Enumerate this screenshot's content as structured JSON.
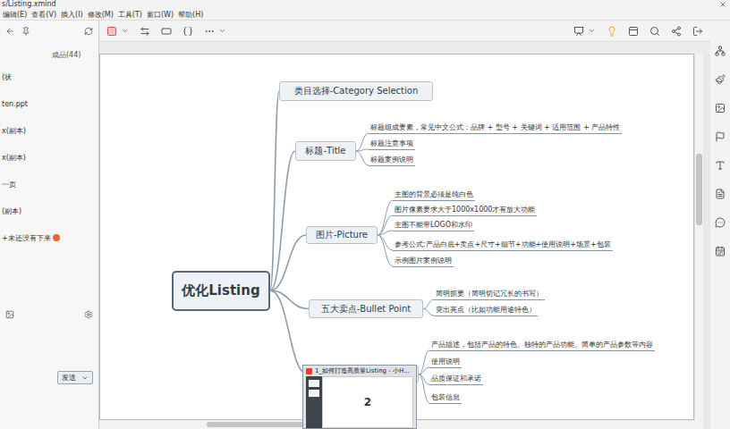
{
  "window": {
    "title": "s/Listing.xmind"
  },
  "menu": [
    "编辑(E)",
    "查看(V)",
    "插入(I)",
    "修改(M)",
    "工具(T)",
    "窗口(W)",
    "帮助(H)"
  ],
  "side_panel": {
    "group": "成品(44)",
    "items": [
      {
        "label": "(状",
        "badge": false
      },
      {
        "label": "ten.ppt",
        "badge": false
      },
      {
        "label": "x(副本)",
        "badge": false
      },
      {
        "label": "x(副本)",
        "badge": false
      },
      {
        "label": "一页",
        "badge": false
      },
      {
        "label": "(副本)",
        "badge": false
      },
      {
        "label": "+未还没有下来",
        "badge": true
      }
    ],
    "send_button": "发送"
  },
  "mindmap": {
    "root": "优化Listing",
    "branches": [
      {
        "label": "类目选择-Category Selection",
        "children": []
      },
      {
        "label": "标题-Title",
        "children": [
          "标题组成要素，常见中文公式：品牌 + 型号 + 关键词 + 适用范围 + 产品特性",
          "标题注意事项",
          "标题案例说明"
        ]
      },
      {
        "label": "图片-Picture",
        "children": [
          "主图的背景必须是纯白色",
          "图片像素要求大于1000x1000才有放大功能",
          "主图不能带LOGO和水印",
          "参考公式:产品白底+卖点+尺寸+细节+功能+使用说明+场景+包装",
          "示例图片案例说明"
        ]
      },
      {
        "label": "五大卖点-Bullet Point",
        "children": [
          "简明扼要（简明切记冗长的书写）",
          "突出亮点（比如功能用途特色）"
        ]
      },
      {
        "children": [
          "产品描述，包括产品的特色、独特的产品功能、简单的产品参数等内容",
          "使用说明",
          "品质保证和承诺",
          "包装信息"
        ]
      }
    ]
  },
  "preview": {
    "title": "1_如何打造高质量Listing - 小H...",
    "page": "2"
  }
}
